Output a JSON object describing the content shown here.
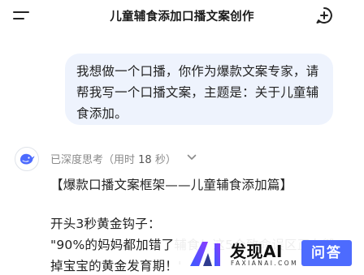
{
  "header": {
    "title": "儿童辅食添加口播文案创作"
  },
  "conversation": {
    "user_message": [
      "我想做一个口播，你作为爆款文案专家，请",
      "帮我写一个口播文案，主题是：关于儿童辅",
      "食添加。"
    ],
    "thinking": {
      "prefix": "已深度思考（用时",
      "seconds": "18",
      "suffix": "秒）"
    },
    "response": {
      "heading": "【爆款口播文案框架——儿童辅食添加篇】",
      "section_title": "开头3秒黄金钩子：",
      "hook_line1": "\"90%的妈妈都加错了辅食！这5个致命误区正在毁",
      "hook_line2": "掉宝宝的黄金发育期！'"
    }
  },
  "watermark": {
    "brand": "发现AI",
    "subtitle": "FAXIANAI.COM",
    "badge": "问答"
  },
  "colors": {
    "bubble": "#eef3fd",
    "accent": "#4d6bfe"
  },
  "icons": {
    "menu": "menu-icon",
    "new_chat": "new-chat-icon",
    "avatar": "deepseek-whale-icon",
    "expand": "chevron-down-icon"
  }
}
